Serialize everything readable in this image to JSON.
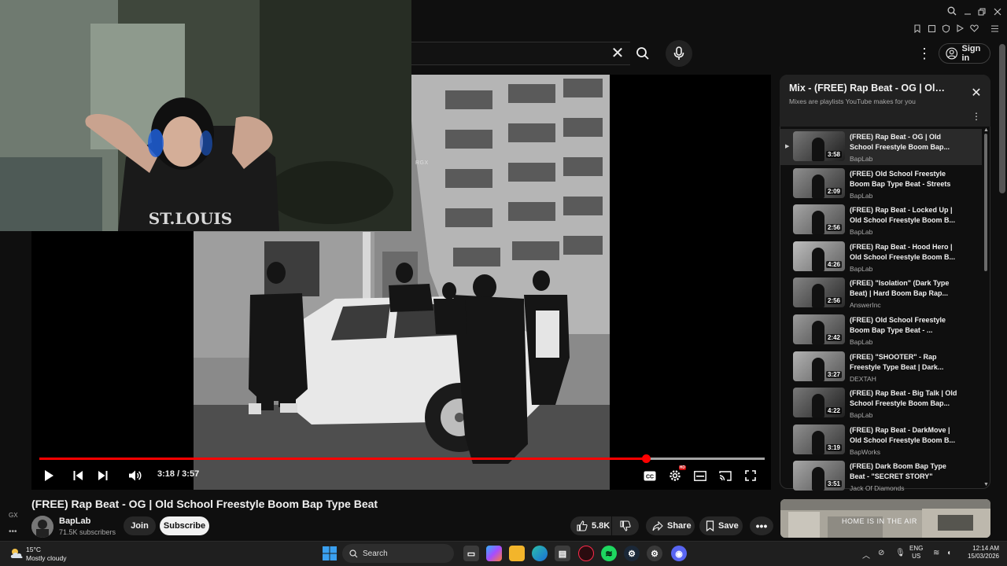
{
  "browser": {
    "top_icons": [
      "search-icon",
      "minimize-icon",
      "restore-icon",
      "close-icon"
    ],
    "toolbar_icons": [
      "bookmark-icon",
      "screenshot-icon",
      "shield-icon",
      "play-icon",
      "heart-icon",
      "sidebar-icon"
    ]
  },
  "header": {
    "signin_label": "Sign in",
    "clear_symbol": "✕",
    "more_symbol": "⋮"
  },
  "player": {
    "watermark": "RGX",
    "time_display": "3:18 / 3:57",
    "progress": {
      "played_fraction": 0.836,
      "loaded_fraction": 1.0
    },
    "hd_badge": "HD",
    "controls": [
      "play-icon",
      "previous-icon",
      "next-icon",
      "volume-icon",
      "captions-icon",
      "settings-icon",
      "miniplayer-icon",
      "cast-icon",
      "fullscreen-icon"
    ]
  },
  "video": {
    "title": "(FREE) Rap Beat - OG | Old School Freestyle Boom Bap Type Beat",
    "channel": "BapLab",
    "subscribers": "71.5K subscribers",
    "join_label": "Join",
    "subscribe_label": "Subscribe",
    "likes": "5.8K",
    "share_label": "Share",
    "save_label": "Save",
    "more_label": "•••"
  },
  "left_strip": {
    "gx": "GX",
    "dots": "•••"
  },
  "playlist": {
    "title": "Mix - (FREE) Rap Beat - OG | Old School Freestyle Boom Bap Type Beat",
    "subtitle": "Mixes are playlists YouTube makes for you",
    "close_symbol": "✕",
    "kebab_symbol": "⋮",
    "active_marker": "▶",
    "items": [
      {
        "title": "(FREE) Rap Beat - OG | Old School Freestyle Boom Bap...",
        "channel": "BapLab",
        "duration": "3:58",
        "active": true
      },
      {
        "title": "(FREE) Old School Freestyle Boom Bap Type Beat - Streets",
        "channel": "BapLab",
        "duration": "2:09",
        "active": false
      },
      {
        "title": "(FREE) Rap Beat - Locked Up | Old School Freestyle Boom B...",
        "channel": "BapLab",
        "duration": "2:56",
        "active": false
      },
      {
        "title": "(FREE) Rap Beat - Hood Hero | Old School Freestyle Boom B...",
        "channel": "BapLab",
        "duration": "4:26",
        "active": false
      },
      {
        "title": "(FREE) \"Isolation\" (Dark Type Beat) | Hard Boom Bap Rap...",
        "channel": "AnswerInc",
        "duration": "2:56",
        "active": false
      },
      {
        "title": "(FREE) Old School Freestyle Boom Bap Type Beat - ...",
        "channel": "BapLab",
        "duration": "2:42",
        "active": false
      },
      {
        "title": "(FREE) \"SHOOTER\" - Rap Freestyle Type Beat | Dark...",
        "channel": "DEXTAH",
        "duration": "3:27",
        "active": false
      },
      {
        "title": "(FREE) Rap Beat - Big Talk | Old School Freestyle Boom Bap...",
        "channel": "BapLab",
        "duration": "4:22",
        "active": false
      },
      {
        "title": "(FREE) Rap Beat - DarkMove | Old School Freestyle Boom B...",
        "channel": "BapWorks",
        "duration": "3:19",
        "active": false
      },
      {
        "title": "(FREE) Dark Boom Bap Type Beat - \"SECRET STORY\"",
        "channel": "Jack Of Diamonds",
        "duration": "3:51",
        "active": false
      }
    ]
  },
  "ad": {
    "text": "HOME IS IN THE AIR"
  },
  "taskbar": {
    "weather_temp": "15°C",
    "weather_desc": "Mostly cloudy",
    "search_label": "Search",
    "lang_line1": "ENG",
    "lang_line2": "US",
    "time": "12:14 AM",
    "date": "15/03/2026",
    "apps": [
      "file-explorer-icon",
      "copilot-icon",
      "folder-icon",
      "edge-icon",
      "store-icon",
      "opera-gx-icon",
      "spotify-icon",
      "steam-icon",
      "discord-icon",
      "discord-notification-icon"
    ]
  },
  "colors": {
    "background": "#0f0f0f",
    "accent_red": "#ff0000",
    "panel_dark": "#212121",
    "pill": "#272727"
  }
}
